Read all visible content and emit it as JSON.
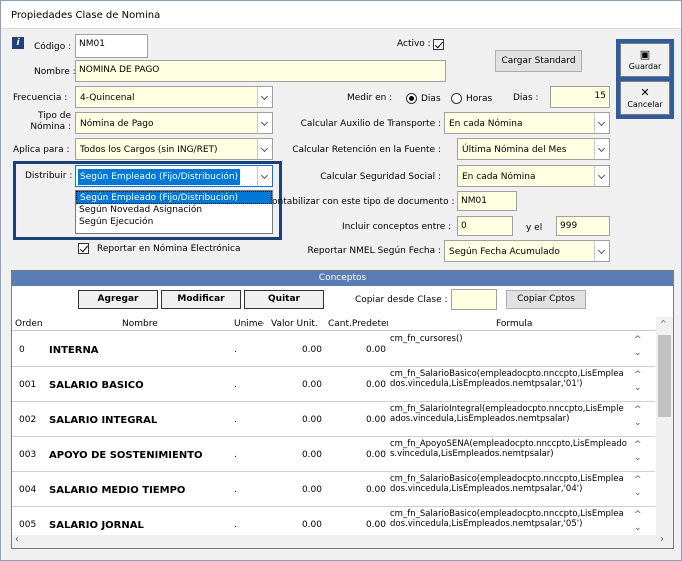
{
  "window": {
    "title": "Propiedades Clase de Nomina"
  },
  "form": {
    "codigo_label": "Código :",
    "codigo_value": "NM01",
    "activo_label": "Activo :",
    "cargar_standard": "Cargar Standard",
    "nombre_label": "Nombre :",
    "nombre_value": "NOMINA DE PAGO",
    "frecuencia_label": "Frecuencia :",
    "frecuencia_value": "4-Quincenal",
    "medir_label": "Medir en :",
    "radio_dias": "Dias",
    "radio_horas": "Horas",
    "dias_label": "Dias :",
    "dias_value": "15",
    "tipo_label_1": "Tipo de",
    "tipo_label_2": "Nómina :",
    "tipo_value": "Nómina de Pago",
    "aux_label": "Calcular Auxilio de Transporte :",
    "aux_value": "En cada Nómina",
    "aplica_label": "Aplica para :",
    "aplica_value": "Todos los Cargos (sin ING/RET)",
    "ret_label": "Calcular Retención en la Fuente :",
    "ret_value": "Última Nómina del Mes",
    "distribuir_label": "Distribuir :",
    "distribuir_value": "Según Empleado (Fijo/Distribución)",
    "distribuir_options": [
      "Según Empleado (Fijo/Distribución)",
      "Según Novedad Asignación",
      "Según Ejecución"
    ],
    "seg_label": "Calcular Seguridad Social :",
    "seg_value": "En cada Nómina",
    "contab_label": "ontabilizar con este tipo de documento :",
    "contab_value": "NM01",
    "incluir_label": "Incluir conceptos entre :",
    "incluir_from": "0",
    "yel_label": "y el",
    "incluir_to": "999",
    "reportar_label": "Reportar en Nómina Electrónica",
    "nmel_label": "Reportar NMEL Según Fecha :",
    "nmel_value": "Según Fecha Acumulado"
  },
  "toolbar": {
    "guardar": "Guardar",
    "cancelar": "Cancelar"
  },
  "conceptos": {
    "title": "Conceptos",
    "agregar": "Agregar",
    "modificar": "Modificar",
    "quitar": "Quitar",
    "copiar_label": "Copiar desde Clase :",
    "copiar_btn": "Copiar Cptos",
    "columns": [
      "Orden",
      "Nombre",
      "Unimed",
      "Valor Unit.",
      "Cant.Predetermi",
      "Formula"
    ],
    "rows": [
      {
        "orden": "0",
        "nombre": "INTERNA",
        "uni": ".",
        "valor": "0.00",
        "cant": "0.00",
        "formula": "cm_fn_cursores()"
      },
      {
        "orden": "001",
        "nombre": "SALARIO BASICO",
        "uni": ".",
        "valor": "0.00",
        "cant": "0.00",
        "formula": "cm_fn_SalarioBasico(empleadocpto.nnccpto,LisEmpleados.vincedula,LisEmpleados.nemtpsalar,'01')"
      },
      {
        "orden": "002",
        "nombre": "SALARIO INTEGRAL",
        "uni": ".",
        "valor": "0.00",
        "cant": "0.00",
        "formula": "cm_fn_SalarioIntegral(empleadocpto.nnccpto,LisEmpleados.vincedula,LisEmpleados.nemtpsalar)"
      },
      {
        "orden": "003",
        "nombre": "APOYO DE SOSTENIMIENTO",
        "uni": ".",
        "valor": "0.00",
        "cant": "0.00",
        "formula": "cm_fn_ApoyoSENA(empleadocpto.nnccpto,LisEmpleados.vincedula,LisEmpleados.nemtpsalar)"
      },
      {
        "orden": "004",
        "nombre": "SALARIO MEDIO TIEMPO",
        "uni": ".",
        "valor": "0.00",
        "cant": "0.00",
        "formula": "cm_fn_SalarioBasico(empleadocpto.nnccpto,LisEmpleados.vincedula,LisEmpleados.nemtpsalar,'04')"
      },
      {
        "orden": "005",
        "nombre": "SALARIO JORNAL",
        "uni": ".",
        "valor": "0.00",
        "cant": "0.00",
        "formula": "cm_fn_SalarioBasico(empleadocpto.nnccpto,LisEmpleados.vincedula,LisEmpleados.nemtpsalar,'05')"
      }
    ]
  },
  "icons": {
    "info": "info-icon",
    "save": "floppy-disk-icon",
    "cancel": "x-cross-icon"
  }
}
